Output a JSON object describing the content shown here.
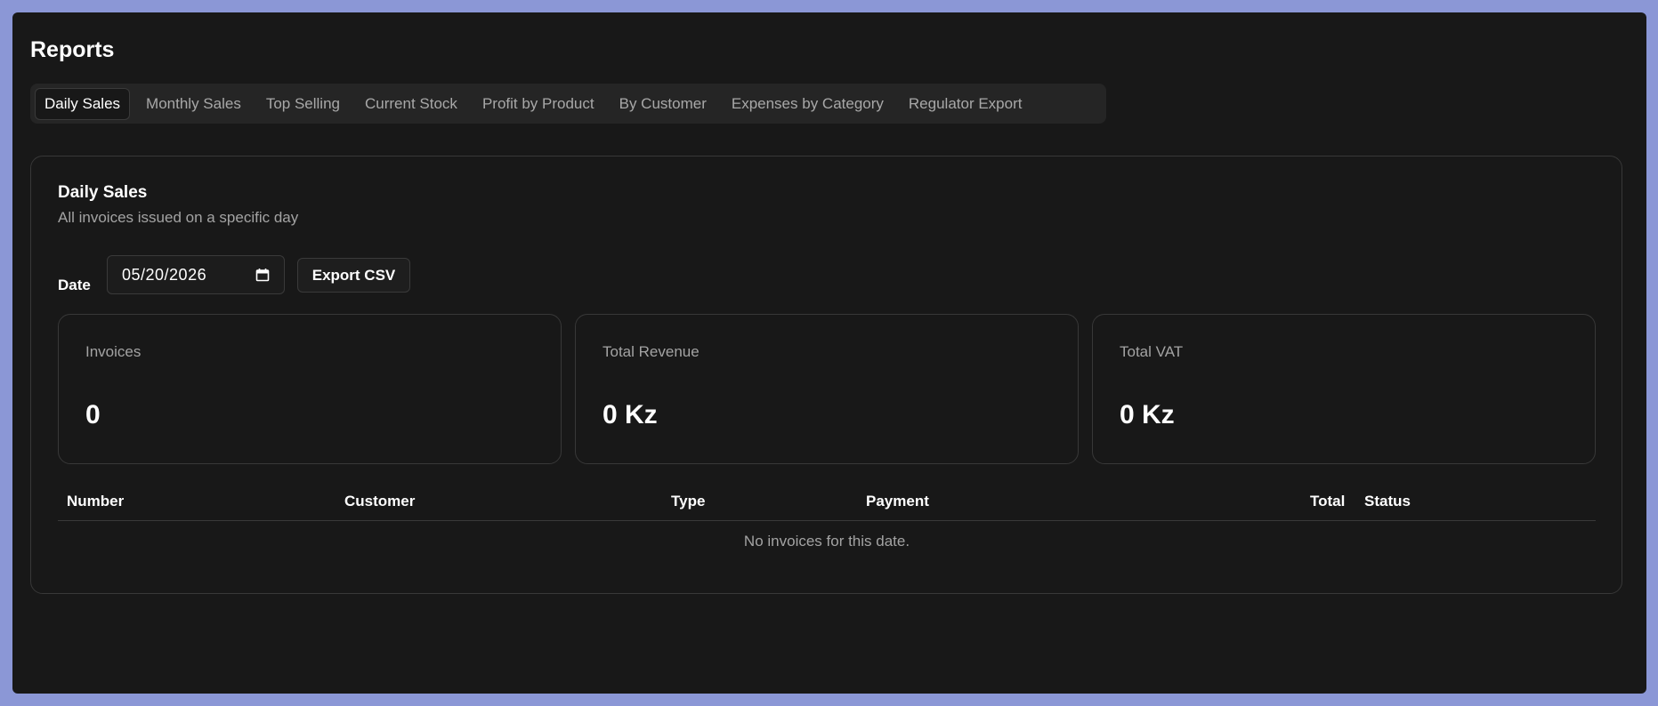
{
  "page": {
    "title": "Reports"
  },
  "tabs": [
    {
      "label": "Daily Sales",
      "active": true
    },
    {
      "label": "Monthly Sales",
      "active": false
    },
    {
      "label": "Top Selling",
      "active": false
    },
    {
      "label": "Current Stock",
      "active": false
    },
    {
      "label": "Profit by Product",
      "active": false
    },
    {
      "label": "By Customer",
      "active": false
    },
    {
      "label": "Expenses by Category",
      "active": false
    },
    {
      "label": "Regulator Export",
      "active": false
    }
  ],
  "report": {
    "title": "Daily Sales",
    "subtitle": "All invoices issued on a specific day",
    "date_label": "Date",
    "date_value": "05/20/2026",
    "date_icon": "calendar-icon",
    "export_label": "Export CSV"
  },
  "stats": [
    {
      "label": "Invoices",
      "value": "0"
    },
    {
      "label": "Total Revenue",
      "value": "0 Kz"
    },
    {
      "label": "Total VAT",
      "value": "0 Kz"
    }
  ],
  "table": {
    "columns": [
      "Number",
      "Customer",
      "Type",
      "Payment",
      "Total",
      "Status"
    ],
    "rows": [],
    "empty_text": "No invoices for this date."
  },
  "colors": {
    "page_background": "#8b97d6",
    "window_background": "#181818",
    "border": "#383838",
    "muted_text": "#a3a3a3"
  }
}
